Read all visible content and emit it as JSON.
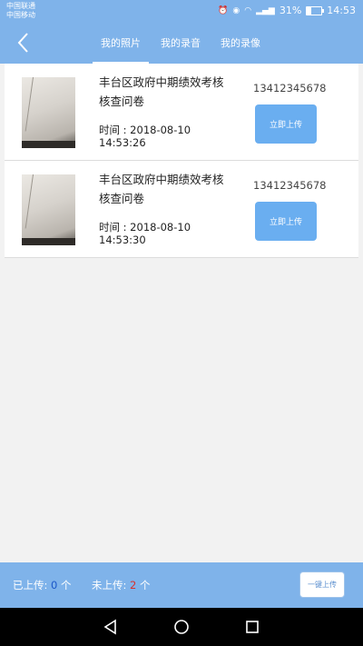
{
  "status_bar": {
    "carrier1": "中国联通",
    "carrier2": "中国移动",
    "battery_percent": "31%",
    "time": "14:53",
    "battery_level": 0.31
  },
  "tabs": [
    {
      "label": "我的照片",
      "active": true
    },
    {
      "label": "我的录音",
      "active": false
    },
    {
      "label": "我的录像",
      "active": false
    }
  ],
  "items": [
    {
      "title": "丰台区政府中期绩效考核核查问卷",
      "time_label": "时间 : 2018-08-10",
      "time_value": "14:53:26",
      "phone": "13412345678",
      "button": "立即上传"
    },
    {
      "title": "丰台区政府中期绩效考核核查问卷",
      "time_label": "时间 : 2018-08-10",
      "time_value": "14:53:30",
      "phone": "13412345678",
      "button": "立即上传"
    }
  ],
  "footer": {
    "uploaded_label": "已上传:",
    "uploaded_count": "0",
    "pending_label": "未上传:",
    "pending_count": "2",
    "unit": "个",
    "one_click_button": "一键上传"
  },
  "colors": {
    "header": "#7fb3ea",
    "button": "#6aaef0",
    "uploaded_count": "#1b57c9",
    "pending_count": "#d7322e"
  },
  "icons": {
    "back": "back-arrow-icon",
    "nav_back": "nav-back-icon",
    "nav_home": "nav-home-icon",
    "nav_recent": "nav-recent-icon"
  }
}
